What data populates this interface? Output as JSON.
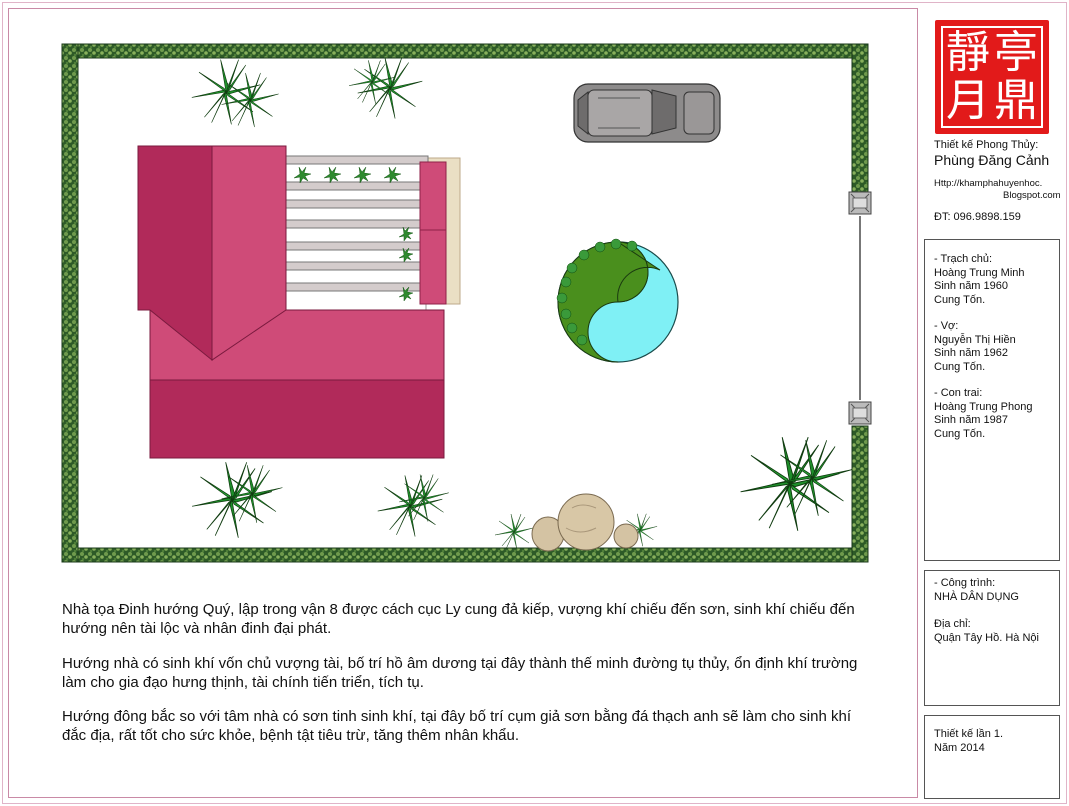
{
  "seal": {
    "chars": [
      "亭",
      "鼎",
      "靜",
      "月"
    ]
  },
  "designer": {
    "label": "Thiết kế Phong Thủy:",
    "name": "Phùng Đăng Cảnh",
    "url_line1": "Http://khamphahuyenhoc.",
    "url_line2": "Blogspot.com",
    "phone": "ĐT: 096.9898.159"
  },
  "family": {
    "owner_label": "- Trạch chủ:",
    "owner_name": "Hoàng Trung Minh",
    "owner_birth": "Sinh năm 1960",
    "owner_palace": "Cung Tốn.",
    "wife_label": "- Vợ:",
    "wife_name": "Nguyễn Thị Hiền",
    "wife_birth": "Sinh năm 1962",
    "wife_palace": "Cung Tốn.",
    "son_label": "- Con trai:",
    "son_name": "Hoàng Trung Phong",
    "son_birth": "Sinh năm 1987",
    "son_palace": "Cung Tốn."
  },
  "project": {
    "label": "- Công trình:",
    "name": "NHÀ DÂN DỤNG",
    "address_label": "Địa chỉ:",
    "address": "Quận Tây Hồ. Hà Nội"
  },
  "revision": {
    "line1": "Thiết kế lần 1.",
    "line2": "Năm 2014"
  },
  "notes": {
    "p1": "Nhà tọa Đinh hướng Quý, lập trong vận 8 được cách cục Ly cung đả kiếp, vượng khí chiếu đến sơn, sinh khí chiếu đến hướng nên tài lộc và nhân đinh đại phát.",
    "p2": "Hướng nhà có sinh khí vốn chủ vượng tài, bố trí hồ âm dương tại đây thành thế minh đường tụ thủy, ổn định khí trường làm cho gia đạo hưng thịnh, tài chính tiến triển, tích tụ.",
    "p3": "Hướng đông bắc so với tâm nhà có sơn tinh sinh khí, tại đây bố trí cụm giả sơn bằng đá thạch anh sẽ làm cho sinh khí đắc địa, rất tốt cho sức khỏe, bệnh tật tiêu trừ, tăng thêm nhân khẩu."
  },
  "colors": {
    "roof": "#cf4b78",
    "roof_dark": "#b12a5a",
    "hedge": "#1f4a1f",
    "pond_yin": "#7ff0f5",
    "pond_yang": "#4a8f1d",
    "seal": "#e21a1a",
    "sand": "#eadfc4"
  }
}
